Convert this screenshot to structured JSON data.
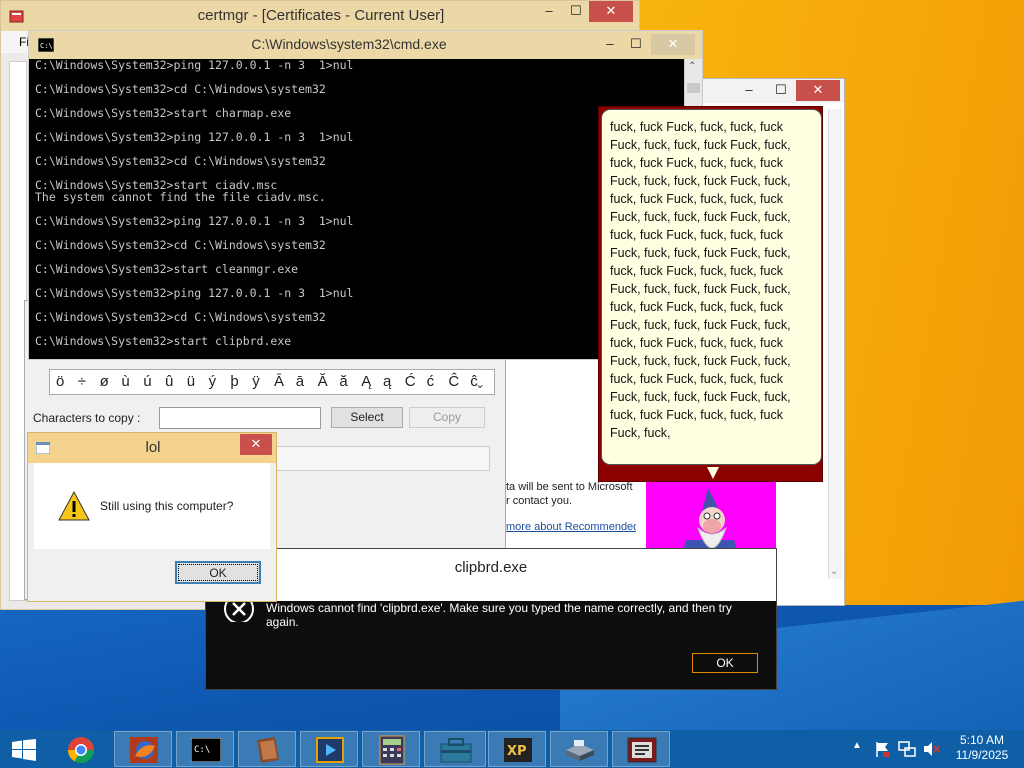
{
  "certmgr": {
    "title": "certmgr - [Certificates - Current User]",
    "menu_initial": "Fi"
  },
  "cmd": {
    "title": "C:\\Windows\\system32\\cmd.exe",
    "lines": [
      "C:\\Windows\\System32>ping 127.0.0.1 -n 3  1>nul",
      "",
      "C:\\Windows\\System32>cd C:\\Windows\\system32",
      "",
      "C:\\Windows\\System32>start charmap.exe",
      "",
      "C:\\Windows\\System32>ping 127.0.0.1 -n 3  1>nul",
      "",
      "C:\\Windows\\System32>cd C:\\Windows\\system32",
      "",
      "C:\\Windows\\System32>start ciadv.msc",
      "The system cannot find the file ciadv.msc.",
      "",
      "C:\\Windows\\System32>ping 127.0.0.1 -n 3  1>nul",
      "",
      "C:\\Windows\\System32>cd C:\\Windows\\system32",
      "",
      "C:\\Windows\\System32>start cleanmgr.exe",
      "",
      "C:\\Windows\\System32>ping 127.0.0.1 -n 3  1>nul",
      "",
      "C:\\Windows\\System32>cd C:\\Windows\\system32",
      "",
      "C:\\Windows\\System32>start clipbrd.exe"
    ]
  },
  "charmap": {
    "chars": [
      "ö",
      "÷",
      "ø",
      "ù",
      "ú",
      "û",
      "ü",
      "ý",
      "þ",
      "ÿ",
      "Ā",
      "ā",
      "Ă",
      "ă",
      "Ą",
      "ą",
      "Ć",
      "ć",
      "Ĉ",
      "ĉ"
    ],
    "chars_label": "Characters to copy :",
    "select_label": "Select",
    "copy_label": "Copy"
  },
  "setup": {
    "privacy_text": "ta will be sent to Microsoft if you use recommended settings, but the informat",
    "privacy_text2": "r contact you.",
    "link_text": "more about Recommended settings, read the Privacy Statement online."
  },
  "speech": {
    "text": "fuck, fuck Fuck, fuck, fuck, fuck\nFuck, fuck, fuck, fuck Fuck, fuck,\nfuck, fuck Fuck, fuck, fuck, fuck\nFuck, fuck, fuck, fuck Fuck, fuck,\nfuck, fuck Fuck, fuck, fuck, fuck\nFuck, fuck, fuck, fuck Fuck, fuck,\nfuck, fuck Fuck, fuck, fuck, fuck\nFuck, fuck, fuck, fuck Fuck, fuck,\nfuck, fuck Fuck, fuck, fuck, fuck\nFuck, fuck, fuck, fuck Fuck, fuck,\nfuck, fuck Fuck, fuck, fuck, fuck\nFuck, fuck, fuck, fuck Fuck, fuck,\nfuck, fuck Fuck, fuck, fuck, fuck\nFuck, fuck, fuck, fuck Fuck, fuck,\nfuck, fuck Fuck, fuck, fuck, fuck\nFuck, fuck, fuck, fuck Fuck, fuck,\nfuck, fuck Fuck, fuck, fuck, fuck\nFuck, fuck,"
  },
  "error_dialog": {
    "title": "clipbrd.exe",
    "message_line1": "Windows cannot find 'clipbrd.exe'. Make sure you typed the name correctly, and then try",
    "message_line2": "again.",
    "ok_label": "OK"
  },
  "lol_dialog": {
    "title": "lol",
    "message": "Still using this computer?",
    "ok_label": "OK"
  },
  "taskbar": {
    "time": "5:10 AM",
    "date": "11/9/2025",
    "items": [
      "start-icon",
      "chrome-icon",
      "firefox-icon",
      "cmd-icon",
      "winrar-icon",
      "media-player-icon",
      "calculator-icon",
      "toolbox-icon",
      "xp-icon",
      "scanner-icon",
      "charmap-icon"
    ]
  },
  "colors": {
    "accent_title": "#ecd8a7",
    "close_red": "#c7504b",
    "taskbar_blue": "#0f5fa6",
    "speech_bg": "#ffffe1",
    "wizard_bg": "#ff00ff"
  }
}
